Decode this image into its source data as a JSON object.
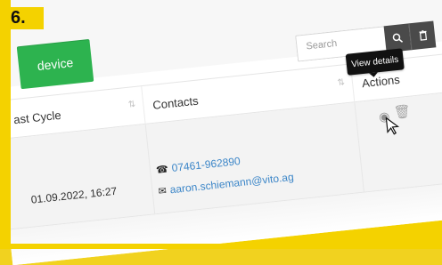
{
  "badge": {
    "step": "6."
  },
  "toolbar": {
    "add_device_label": "device",
    "search_placeholder": "Search"
  },
  "table": {
    "headers": {
      "last_cycle": "ast Cycle",
      "contacts": "Contacts",
      "actions": "Actions"
    },
    "rows": [
      {
        "last_cycle": "01.09.2022, 16:27",
        "phone": "07461-962890",
        "email": "aaron.schiemann@vito.ag"
      }
    ]
  },
  "tooltip": {
    "view_details": "View details"
  },
  "icons": {
    "search": "search-icon",
    "trash": "trash-icon",
    "phone": "phone-icon",
    "email": "mail-icon",
    "eye": "eye-icon",
    "cursor": "cursor-icon"
  },
  "colors": {
    "frame": "#f4d200",
    "button_green": "#2db34f",
    "link_blue": "#3c86c8",
    "dark_button": "#4a4a4a",
    "tooltip_bg": "#111111"
  }
}
